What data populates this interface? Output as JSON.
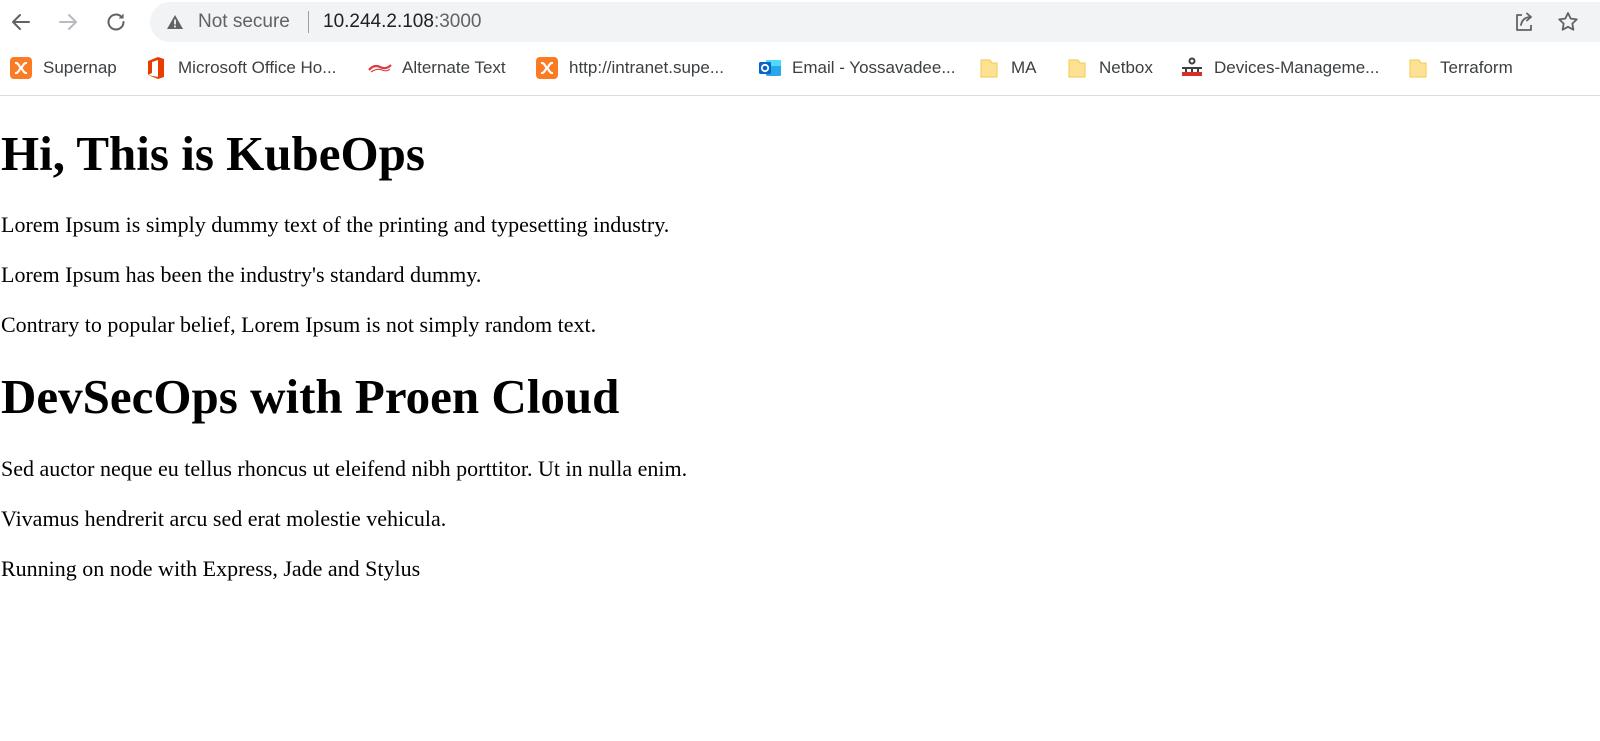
{
  "browser": {
    "security_label": "Not secure",
    "url_host": "10.244.2.108",
    "url_port": ":3000"
  },
  "bookmarks": [
    {
      "label": "Supernap",
      "icon": "xampp-icon"
    },
    {
      "label": "Microsoft Office Ho...",
      "icon": "office-icon"
    },
    {
      "label": "Alternate Text",
      "icon": "alternate-text-icon"
    },
    {
      "label": "http://intranet.supe...",
      "icon": "xampp-icon"
    },
    {
      "label": "Email - Yossavadee...",
      "icon": "outlook-icon"
    },
    {
      "label": "MA",
      "icon": "folder-icon"
    },
    {
      "label": "Netbox",
      "icon": "folder-icon"
    },
    {
      "label": "Devices-Manageme...",
      "icon": "devices-icon"
    },
    {
      "label": "Terraform",
      "icon": "folder-icon"
    }
  ],
  "content": {
    "heading1": "Hi, This is KubeOps",
    "paragraphs1": [
      "Lorem Ipsum is simply dummy text of the printing and typesetting industry.",
      "Lorem Ipsum has been the industry's standard dummy.",
      "Contrary to popular belief, Lorem Ipsum is not simply random text."
    ],
    "heading2": "DevSecOps with Proen Cloud",
    "paragraphs2": [
      "Sed auctor neque eu tellus rhoncus ut eleifend nibh porttitor. Ut in nulla enim.",
      "Vivamus hendrerit arcu sed erat molestie vehicula.",
      "Running on node with Express, Jade and Stylus"
    ]
  },
  "colors": {
    "omnibox_bg": "#f1f3f4",
    "xampp_orange": "#fb7a24",
    "office_red": "#eb3c00",
    "outlook_blue": "#0a64c8",
    "folder_yellow": "#fde293"
  }
}
